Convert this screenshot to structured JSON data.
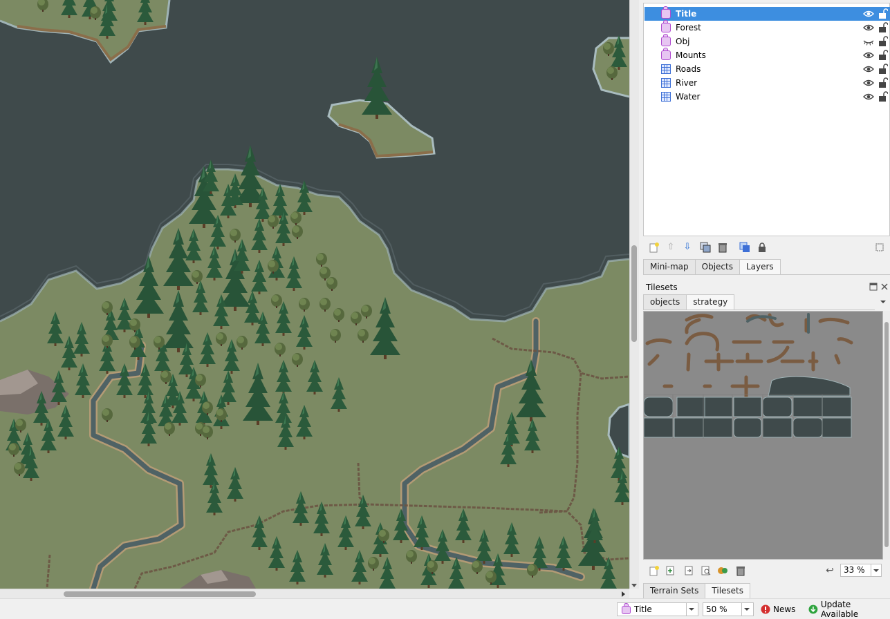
{
  "layers": [
    {
      "name": "Title",
      "type": "group",
      "visible": true,
      "selected": true
    },
    {
      "name": "Forest",
      "type": "group",
      "visible": true,
      "selected": false
    },
    {
      "name": "Obj",
      "type": "group",
      "visible": false,
      "selected": false
    },
    {
      "name": "Mounts",
      "type": "group",
      "visible": true,
      "selected": false
    },
    {
      "name": "Roads",
      "type": "tile",
      "visible": true,
      "selected": false
    },
    {
      "name": "River",
      "type": "tile",
      "visible": true,
      "selected": false
    },
    {
      "name": "Water",
      "type": "tile",
      "visible": true,
      "selected": false
    }
  ],
  "layers_toolbar": [
    "new-layer-icon",
    "raise-layer-icon",
    "lower-layer-icon",
    "duplicate-layer-icon",
    "delete-layer-icon",
    "toggle-other-layers-icon",
    "lock-other-layers-icon"
  ],
  "dock_tabs_top": {
    "minimap": "Mini-map",
    "objects": "Objects",
    "layers": "Layers",
    "active": "Layers"
  },
  "tilesets": {
    "title": "Tilesets",
    "tabs": [
      "objects",
      "strategy"
    ],
    "active_tab": "strategy",
    "zoom": "33 %",
    "toolbar": [
      "new-tileset-icon",
      "embed-tileset-icon",
      "export-tileset-icon",
      "edit-tileset-icon",
      "dynamic-wrapping-icon",
      "remove-tileset-icon"
    ]
  },
  "dock_tabs_bottom": {
    "terrain_sets": "Terrain Sets",
    "tilesets": "Tilesets",
    "active": "Tilesets"
  },
  "statusbar": {
    "current_layer": "Title",
    "zoom": "50 %",
    "news": "News",
    "update": "Update Available"
  },
  "colors": {
    "selection": "#3d8ee0",
    "water": "#3f4a4b",
    "grass": "#7c8a63",
    "forest": "#2f5a3c",
    "tileset_bg": "#8a8a8a"
  }
}
